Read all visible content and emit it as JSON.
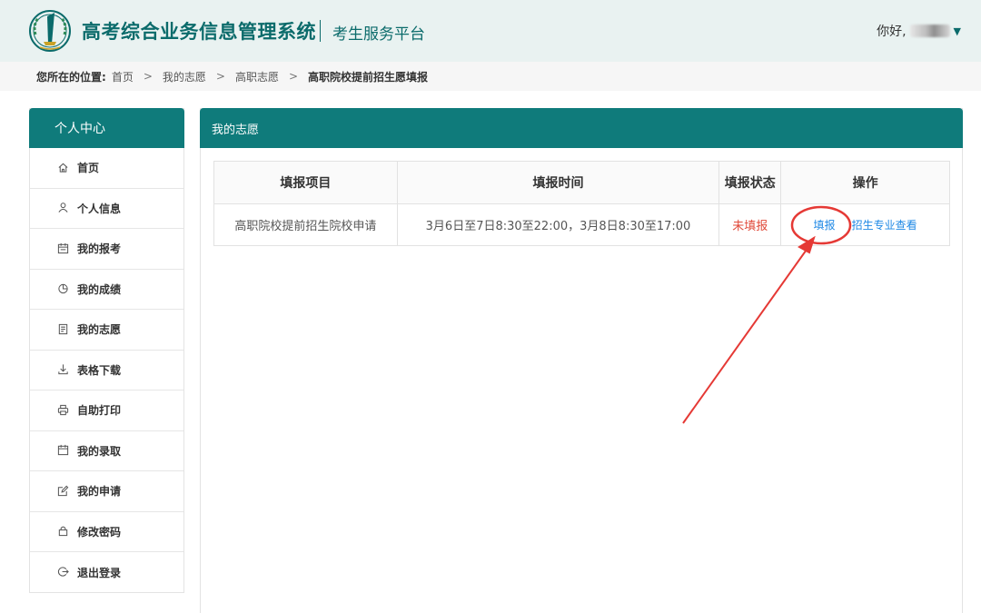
{
  "header": {
    "title": "高考综合业务信息管理系统",
    "subtitle": "考生服务平台",
    "greeting": "你好,"
  },
  "breadcrumb": {
    "label": "您所在的位置:",
    "items": [
      "首页",
      "我的志愿",
      "高职志愿",
      "高职院校提前招生愿填报"
    ],
    "separator": ">"
  },
  "sidebar": {
    "title": "个人中心",
    "items": [
      {
        "label": "首页",
        "icon": "home-icon"
      },
      {
        "label": "个人信息",
        "icon": "user-icon"
      },
      {
        "label": "我的报考",
        "icon": "calendar-icon"
      },
      {
        "label": "我的成绩",
        "icon": "pie-chart-icon"
      },
      {
        "label": "我的志愿",
        "icon": "document-icon"
      },
      {
        "label": "表格下载",
        "icon": "download-icon"
      },
      {
        "label": "自助打印",
        "icon": "printer-icon"
      },
      {
        "label": "我的录取",
        "icon": "calendar-check-icon"
      },
      {
        "label": "我的申请",
        "icon": "edit-icon"
      },
      {
        "label": "修改密码",
        "icon": "lock-icon"
      },
      {
        "label": "退出登录",
        "icon": "logout-icon"
      }
    ]
  },
  "main": {
    "title": "我的志愿",
    "table": {
      "headers": [
        "填报项目",
        "填报时间",
        "填报状态",
        "操作"
      ],
      "rows": [
        {
          "project": "高职院校提前招生院校申请",
          "time": "3月6日至7日8:30至22:00，3月8日8:30至17:00",
          "status": "未填报",
          "actions": [
            "填报",
            "招生专业查看"
          ]
        }
      ]
    }
  },
  "colors": {
    "primary": "#0f7b7b",
    "header_bg": "#e9f2f1",
    "status_unfilled": "#e04a3a",
    "link": "#1e88e5",
    "annotation": "#e53935"
  }
}
